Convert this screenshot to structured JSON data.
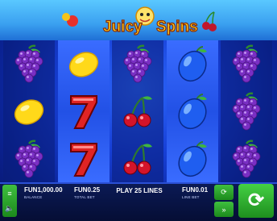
{
  "game": {
    "title_left": "Juicy",
    "title_right": "Spins"
  },
  "reels": [
    [
      "grapes",
      "lemon",
      "grapes"
    ],
    [
      "lemon",
      "seven",
      "seven"
    ],
    [
      "grapes",
      "cherries",
      "cherries"
    ],
    [
      "plum",
      "plum",
      "plum"
    ],
    [
      "grapes",
      "grapes",
      "grapes"
    ]
  ],
  "bottom_bar": {
    "balance_value": "FUN1,000.00",
    "balance_label": "BALANCE",
    "total_bet_value": "FUN0.25",
    "total_bet_label": "TOTAL BET",
    "play_lines": "PLAY 25 LINES",
    "line_bet_value": "FUN0.01",
    "line_bet_label": "LINE BET"
  },
  "icons": {
    "menu": "menu-icon",
    "sound": "speaker-icon",
    "autoplay": "autoplay-icon",
    "fast": "fast-forward-icon",
    "spin": "spin-arrow-icon"
  },
  "colors": {
    "accent_green": "#2aa82a",
    "reel_light": "#2f5ff0",
    "reel_dark": "#0e2a8a"
  }
}
